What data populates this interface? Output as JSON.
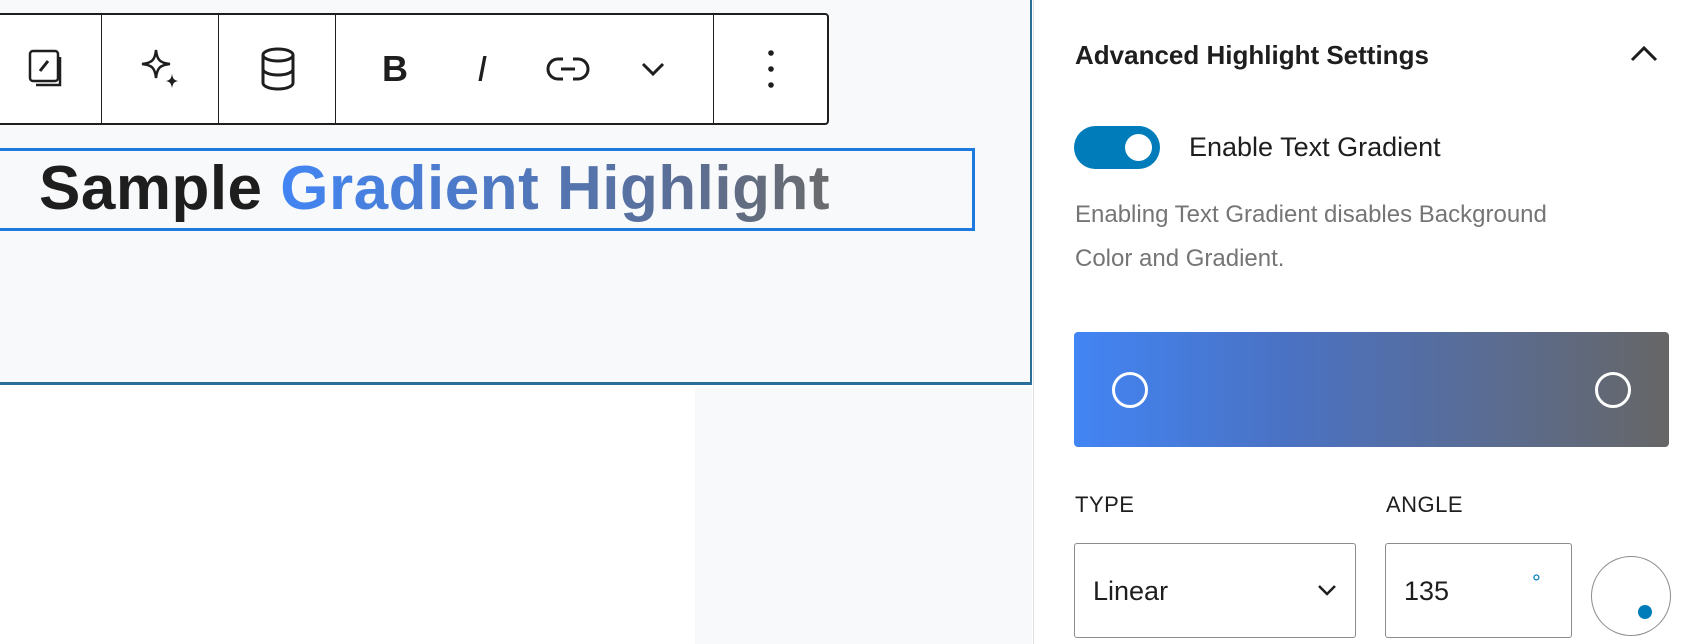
{
  "toolbar": {
    "items": [
      {
        "icon": "image-style-icon"
      },
      {
        "icon": "sparkle-icon"
      },
      {
        "icon": "database-icon"
      },
      {
        "icon": "bold-icon",
        "label": "B"
      },
      {
        "icon": "italic-icon",
        "label": "I"
      },
      {
        "icon": "link-icon"
      },
      {
        "icon": "chevron-down-icon"
      },
      {
        "icon": "more-options-icon"
      }
    ]
  },
  "editor": {
    "heading_plain": "Sample",
    "heading_gradient": "Gradient Highlight"
  },
  "sidebar": {
    "panel_title": "Advanced Highlight Settings",
    "toggle_label": "Enable Text Gradient",
    "toggle_on": true,
    "help_text": "Enabling Text Gradient disables Background Color and Gradient.",
    "gradient": {
      "start_color": "#4285f4",
      "end_color": "#666666"
    },
    "type_label": "TYPE",
    "type_value": "Linear",
    "angle_label": "ANGLE",
    "angle_value": "135",
    "angle_unit": "°"
  },
  "colors": {
    "accent": "#007cba",
    "selection": "#1f7ae0"
  }
}
